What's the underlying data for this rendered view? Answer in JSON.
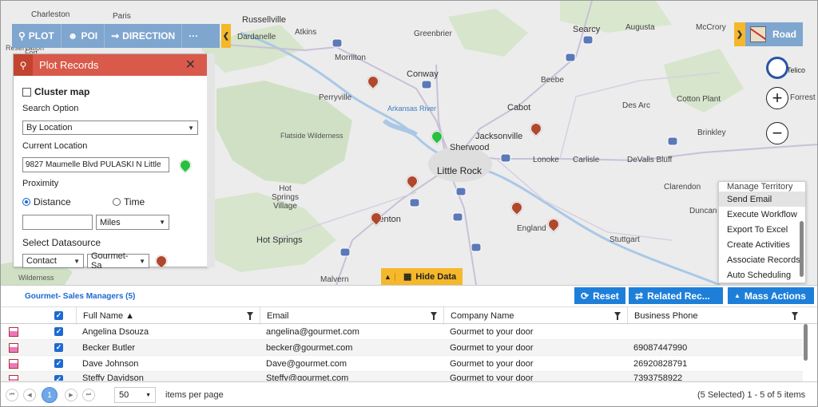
{
  "toolbar": {
    "plot_label": "PLOT",
    "poi_label": "POI",
    "direction_label": "DIRECTION",
    "more_label": "···",
    "collapse_glyph": "❮"
  },
  "map_view": {
    "road_label": "Road",
    "expand_glyph": "❯",
    "telico_text": "Telico",
    "zoom_in": "+",
    "zoom_out": "−",
    "hide_data_label": "Hide Data",
    "labels": {
      "charleston": "Charleston",
      "paris": "Paris",
      "fort": "Fort",
      "reservation": "Reservation",
      "russellville": "Russellville",
      "dardanelle": "Dardanelle",
      "atkins": "Atkins",
      "greenbrier": "Greenbrier",
      "searcy": "Searcy",
      "augusta": "Augusta",
      "mccrory": "McCrory",
      "morrilton": "Morrilton",
      "conway": "Conway",
      "beebe": "Beebe",
      "perryville": "Perryville",
      "arkansas_river": "Arkansas River",
      "cabot": "Cabot",
      "des_arc": "Des Arc",
      "cotton_plant": "Cotton Plant",
      "forrest_city": "Forrest C",
      "jacksonville": "Jacksonville",
      "brinkley": "Brinkley",
      "flatside": "Flatside Wilderness",
      "sherwood": "Sherwood",
      "lonoke": "Lonoke",
      "carlisle": "Carlisle",
      "devalls_bluff": "DeValls Bluff",
      "little_rock": "Little Rock",
      "hot_springs_village": "Hot Springs Village",
      "clarendon": "Clarendon",
      "benton": "Benton",
      "england": "England",
      "duncan": "Duncan",
      "hot_springs": "Hot Springs",
      "stuttgart": "Stuttgart",
      "malvern": "Malvern",
      "wilderness": "Wilderness"
    },
    "highway_shields": [
      "40",
      "167",
      "64",
      "65",
      "40",
      "440",
      "530",
      "70",
      "167",
      "65",
      "30",
      "40",
      "40"
    ]
  },
  "plot_panel": {
    "title": "Plot Records",
    "close_glyph": "✕",
    "cluster_map_label": "Cluster map",
    "search_option_label": "Search Option",
    "search_option_value": "By Location",
    "current_location_label": "Current Location",
    "current_location_value": "9827 Maumelle Blvd PULASKI N Little",
    "proximity_label": "Proximity",
    "distance_label": "Distance",
    "time_label": "Time",
    "distance_value": "",
    "unit_value": "Miles",
    "select_datasource_label": "Select Datasource",
    "entity_value": "Contact",
    "view_value": "Gourmet- Sa"
  },
  "mass_actions_menu": {
    "items": [
      "Manage Territory",
      "Send Email",
      "Execute Workflow",
      "Export To Excel",
      "Create Activities",
      "Associate Records",
      "Auto Scheduling"
    ],
    "highlighted_index": 1
  },
  "grid": {
    "title": "Gourmet- Sales Managers (5)",
    "reset_label": "Reset",
    "related_label": "Related Rec...",
    "mass_actions_label": "Mass Actions",
    "columns": [
      "Full Name ▲",
      "Email",
      "Company Name",
      "Business Phone"
    ],
    "rows": [
      {
        "name": "Angelina Dsouza",
        "email": "angelina@gourmet.com",
        "company": "Gourmet to your door",
        "phone": ""
      },
      {
        "name": "Becker Butler",
        "email": "becker@gourmet.com",
        "company": "Gourmet to your door",
        "phone": "69087447990"
      },
      {
        "name": "Dave Johnson",
        "email": "Dave@gourmet.com",
        "company": "Gourmet to your door",
        "phone": "26920828791"
      },
      {
        "name": "Steffy Davidson",
        "email": "Steffy@gourmet.com",
        "company": "Gourmet to your door",
        "phone": "7393758922"
      }
    ]
  },
  "pager": {
    "current_page": "1",
    "page_size": "50",
    "items_per_page_label": "items per page",
    "summary": "(5 Selected) 1 - 5 of 5 items"
  },
  "colors": {
    "toolbar_blue": "#7fa6cf",
    "accent_orange": "#f5b82a",
    "panel_red": "#d95a4b",
    "button_blue": "#1e7fd9",
    "pin_red": "#b0482e",
    "pin_green": "#27c13e"
  }
}
